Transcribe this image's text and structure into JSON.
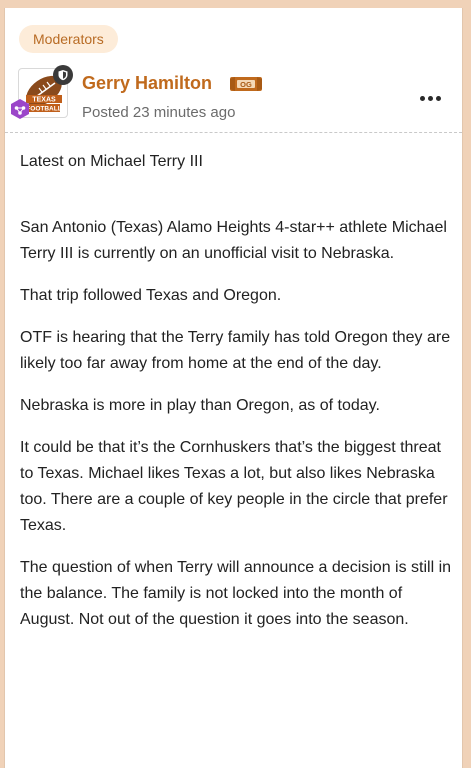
{
  "post": {
    "role_label": "Moderators",
    "author_name": "Gerry Hamilton",
    "author_badge": "OG",
    "timestamp": "Posted 23 minutes ago",
    "avatar_text_top": "TEXAS",
    "avatar_text_bottom": "FOOTBALL",
    "paragraphs": [
      "Latest on Michael Terry III",
      "San Antonio (Texas) Alamo Heights 4-star++ athlete Michael Terry III is currently on an unofficial visit to Nebraska.",
      "That trip followed Texas and Oregon.",
      "OTF is hearing that the Terry family has told Oregon they are likely too far away from home at the end of the day.",
      "Nebraska is more in play than Oregon, as of today.",
      "It could be that it’s the Cornhuskers that’s the biggest threat to Texas. Michael likes Texas a lot, but also likes Nebraska too. There are a couple of key people in the circle that prefer Texas.",
      "The question of when Terry will announce a decision is still in the balance. The family is not locked into the month of August. Not out of the question it goes into the season."
    ]
  },
  "colors": {
    "page_bg": "#f0d2b8",
    "accent": "#c06a1d",
    "badge_bg": "#fdecd9"
  },
  "icons": {
    "group": "shield-icon",
    "rank": "achievement-hexagon-icon",
    "more": "more-horizontal-icon"
  }
}
